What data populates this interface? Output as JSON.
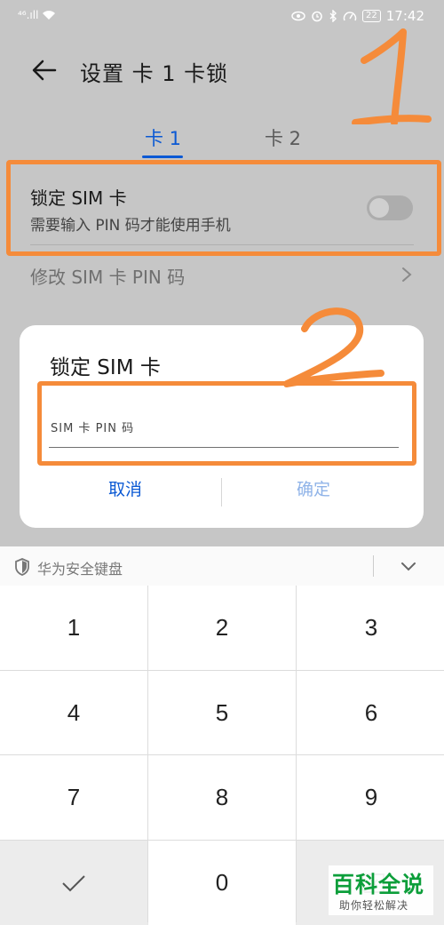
{
  "status_bar": {
    "signal": "⁴⁶.ıll",
    "battery": "22",
    "time": "17:42"
  },
  "header": {
    "title": "设置 卡 1 卡锁"
  },
  "tabs": [
    {
      "label": "卡 1"
    },
    {
      "label": "卡 2"
    }
  ],
  "lock_row": {
    "title": "锁定 SIM 卡",
    "subtitle": "需要输入 PIN 码才能使用手机",
    "enabled": false
  },
  "change_pin_row": {
    "label": "修改 SIM 卡 PIN 码"
  },
  "dialog": {
    "title": "锁定 SIM 卡",
    "input_value": "",
    "input_placeholder": "SIM 卡 PIN 码",
    "cancel_label": "取消",
    "confirm_label": "确定"
  },
  "annotations": {
    "mark1": "1",
    "mark2": "2",
    "color": "#f58b3a"
  },
  "keyboard": {
    "title": "华为安全键盘",
    "keys": [
      "1",
      "2",
      "3",
      "4",
      "5",
      "6",
      "7",
      "8",
      "9",
      "✓",
      "0",
      "⌫"
    ]
  },
  "watermark": {
    "title": "百科全说",
    "subtitle": "助你轻松解决"
  }
}
